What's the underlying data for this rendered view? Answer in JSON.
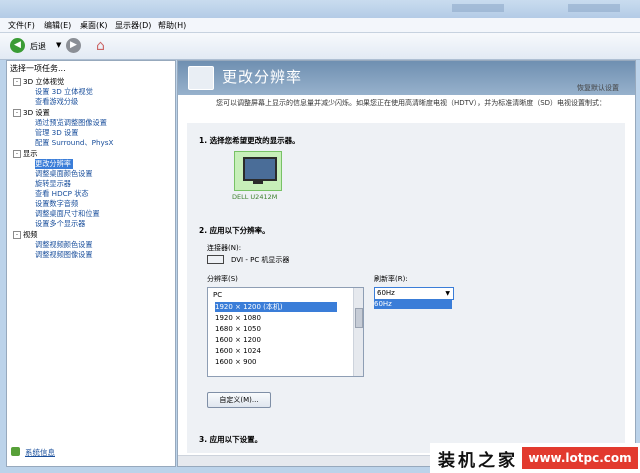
{
  "menu": [
    "文件(F)",
    "编辑(E)",
    "桌面(K)",
    "显示器(D)",
    "帮助(H)"
  ],
  "toolbar": {
    "back_label": "后退"
  },
  "left": {
    "head": "选择一项任务...",
    "items": [
      {
        "label": "3D 立体视觉",
        "kind": "cat"
      },
      {
        "label": "设置 3D 立体视觉",
        "kind": "link"
      },
      {
        "label": "查看游戏分级",
        "kind": "link"
      },
      {
        "label": "3D 设置",
        "kind": "cat"
      },
      {
        "label": "通过预览调整图像设置",
        "kind": "link"
      },
      {
        "label": "管理 3D 设置",
        "kind": "link"
      },
      {
        "label": "配置 Surround、PhysX",
        "kind": "link"
      },
      {
        "label": "显示",
        "kind": "cat"
      },
      {
        "label": "更改分辨率",
        "kind": "sel"
      },
      {
        "label": "调整桌面颜色设置",
        "kind": "link"
      },
      {
        "label": "旋转显示器",
        "kind": "link"
      },
      {
        "label": "查看 HDCP 状态",
        "kind": "link"
      },
      {
        "label": "设置数字音频",
        "kind": "link"
      },
      {
        "label": "调整桌面尺寸和位置",
        "kind": "link"
      },
      {
        "label": "设置多个显示器",
        "kind": "link"
      },
      {
        "label": "视频",
        "kind": "cat"
      },
      {
        "label": "调整视频颜色设置",
        "kind": "link"
      },
      {
        "label": "调整视频图像设置",
        "kind": "link"
      }
    ],
    "system_info": "系统信息"
  },
  "main": {
    "title": "更改分辨率",
    "restore": "恢复默认设置",
    "description": "您可以调整屏幕上显示的信息量并减少闪烁。如果您正在使用高清晰度电视（HDTV），并为标准清晰度（SD）电视设置制式：",
    "section1": "1. 选择您希望更改的显示器。",
    "monitor_name": "DELL U2412M",
    "section2": "2. 应用以下分辨率。",
    "connector_label": "连接器(N):",
    "connector_value": "DVI - PC 机显示器",
    "resolution_label": "分辨率(S)",
    "refresh_label": "刷新率(R):",
    "refresh_value": "60Hz",
    "refresh_option": "60Hz",
    "resolutions": [
      "PC",
      "1920 × 1200 (本机)",
      "1920 × 1080",
      "1680 × 1050",
      "1600 × 1200",
      "1600 × 1024",
      "1600 × 900"
    ],
    "customize": "自定义(M)...",
    "section3": "3. 应用以下设置。"
  },
  "watermark": {
    "cn": "装机之家",
    "url": "www.lotpc.com"
  }
}
